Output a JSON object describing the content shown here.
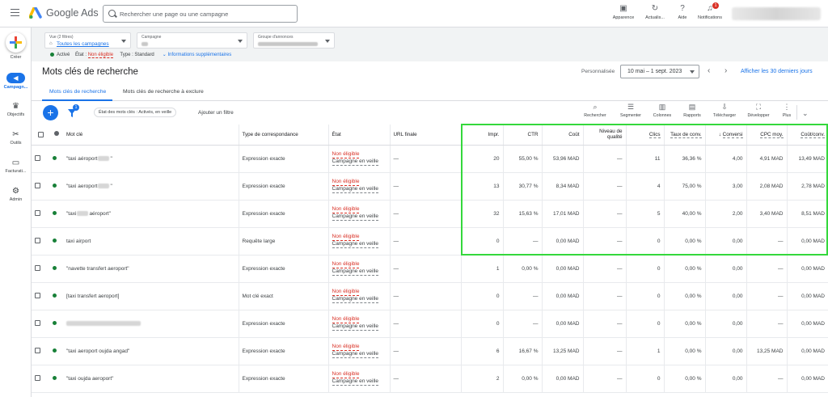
{
  "app": {
    "brand": "Google Ads",
    "search_placeholder": "Rechercher une page ou une campagne",
    "actions": [
      {
        "label": "Apparence",
        "icon": "appearance-icon"
      },
      {
        "label": "Actualis...",
        "icon": "refresh-icon"
      },
      {
        "label": "Aide",
        "icon": "help-icon"
      },
      {
        "label": "Notifications",
        "icon": "bell-icon",
        "badge": "1"
      }
    ]
  },
  "nav": {
    "create_label": "Créer",
    "items": [
      {
        "label": "Campagn...",
        "icon": "megaphone-icon"
      },
      {
        "label": "Objectifs",
        "icon": "trophy-icon"
      },
      {
        "label": "Outils",
        "icon": "tools-icon"
      },
      {
        "label": "Facturati...",
        "icon": "billing-icon"
      },
      {
        "label": "Admin",
        "icon": "admin-gear-icon"
      }
    ]
  },
  "filters": {
    "view_label": "Vue (2 filtres)",
    "view_value": "Toutes les campagnes",
    "campaign_label": "Campagne",
    "adgroup_label": "Groupe d'annonces",
    "status_active": "Activé",
    "status_label": "État :",
    "status_value": "Non éligible",
    "type_label": "Type :",
    "type_value": "Standard",
    "more_info": "Informations supplémentaires"
  },
  "page": {
    "title": "Mots clés de recherche",
    "personalize": "Personnalisée",
    "date_range": "10 mai – 1 sept. 2023",
    "last30": "Afficher les 30 derniers jours",
    "tabs": [
      "Mots clés de recherche",
      "Mots clés de recherche à exclure"
    ],
    "filter_badge": "1",
    "filter_chip": "État des mots clés : Activés, en veille",
    "add_filter": "Ajouter un filtre",
    "tools": [
      {
        "label": "Rechercher",
        "icon": "search-icon"
      },
      {
        "label": "Segmenter",
        "icon": "segment-icon"
      },
      {
        "label": "Colonnes",
        "icon": "columns-icon"
      },
      {
        "label": "Rapports",
        "icon": "reports-icon"
      },
      {
        "label": "Télécharger",
        "icon": "download-icon"
      },
      {
        "label": "Développer",
        "icon": "expand-icon"
      },
      {
        "label": "Plus",
        "icon": "more-icon"
      }
    ]
  },
  "table": {
    "headers": {
      "keyword": "Mot clé",
      "match": "Type de correspondance",
      "state": "État",
      "url": "URL finale",
      "impr": "Impr.",
      "ctr": "CTR",
      "cost": "Coût",
      "quality": "Niveau de qualité",
      "clicks": "Clics",
      "conv_rate": "Taux de conv.",
      "conversions": "Conversi",
      "cpc": "CPC moy.",
      "cost_conv": "Coût/conv."
    },
    "rows": [
      {
        "kw_pre": "\"taxi aéroport",
        "kw_post": "\"",
        "blur_mid": true,
        "match": "Expression exacte",
        "s1": "Non éligible",
        "s2": "Campagne en veille",
        "url": "—",
        "impr": "20",
        "ctr": "55,00 %",
        "cost": "53,96 MAD",
        "quality": "—",
        "clicks": "11",
        "conv_rate": "36,36 %",
        "conversions": "4,00",
        "cpc": "4,91 MAD",
        "cost_conv": "13,49 MAD"
      },
      {
        "kw_pre": "\"taxi aeroport",
        "kw_post": "\"",
        "blur_mid": true,
        "match": "Expression exacte",
        "s1": "Non éligible",
        "s2": "Campagne en veille",
        "url": "—",
        "impr": "13",
        "ctr": "30,77 %",
        "cost": "8,34 MAD",
        "quality": "—",
        "clicks": "4",
        "conv_rate": "75,00 %",
        "conversions": "3,00",
        "cpc": "2,08 MAD",
        "cost_conv": "2,78 MAD"
      },
      {
        "kw_pre": "\"taxi",
        "kw_post": "aéroport\"",
        "blur_mid": true,
        "match": "Expression exacte",
        "s1": "Non éligible",
        "s2": "Campagne en veille",
        "url": "—",
        "impr": "32",
        "ctr": "15,63 %",
        "cost": "17,01 MAD",
        "quality": "—",
        "clicks": "5",
        "conv_rate": "40,00 %",
        "conversions": "2,00",
        "cpc": "3,40 MAD",
        "cost_conv": "8,51 MAD"
      },
      {
        "kw_pre": "taxi airport",
        "kw_post": "",
        "blur_mid": false,
        "match": "Requête large",
        "s1": "Non éligible",
        "s2": "Campagne en veille",
        "url": "—",
        "impr": "0",
        "ctr": "—",
        "cost": "0,00 MAD",
        "quality": "—",
        "clicks": "0",
        "conv_rate": "0,00 %",
        "conversions": "0,00",
        "cpc": "—",
        "cost_conv": "0,00 MAD"
      },
      {
        "kw_pre": "\"navette transfert aeroport\"",
        "kw_post": "",
        "blur_mid": false,
        "match": "Expression exacte",
        "s1": "Non éligible",
        "s2": "Campagne en veille",
        "url": "—",
        "impr": "1",
        "ctr": "0,00 %",
        "cost": "0,00 MAD",
        "quality": "—",
        "clicks": "0",
        "conv_rate": "0,00 %",
        "conversions": "0,00",
        "cpc": "—",
        "cost_conv": "0,00 MAD"
      },
      {
        "kw_pre": "[taxi transfert aeroport]",
        "kw_post": "",
        "blur_mid": false,
        "match": "Mot clé exact",
        "s1": "Non éligible",
        "s2": "Campagne en veille",
        "url": "—",
        "impr": "0",
        "ctr": "—",
        "cost": "0,00 MAD",
        "quality": "—",
        "clicks": "0",
        "conv_rate": "0,00 %",
        "conversions": "0,00",
        "cpc": "—",
        "cost_conv": "0,00 MAD"
      },
      {
        "kw_pre": "",
        "kw_post": "",
        "blur_mid": false,
        "blur_full": true,
        "match": "Expression exacte",
        "s1": "Non éligible",
        "s2": "Campagne en veille",
        "url": "—",
        "impr": "0",
        "ctr": "—",
        "cost": "0,00 MAD",
        "quality": "—",
        "clicks": "0",
        "conv_rate": "0,00 %",
        "conversions": "0,00",
        "cpc": "—",
        "cost_conv": "0,00 MAD"
      },
      {
        "kw_pre": "\"taxi aeroport oujda angad\"",
        "kw_post": "",
        "blur_mid": false,
        "match": "Expression exacte",
        "s1": "Non éligible",
        "s2": "Campagne en veille",
        "url": "—",
        "impr": "6",
        "ctr": "16,67 %",
        "cost": "13,25 MAD",
        "quality": "—",
        "clicks": "1",
        "conv_rate": "0,00 %",
        "conversions": "0,00",
        "cpc": "13,25 MAD",
        "cost_conv": "0,00 MAD"
      },
      {
        "kw_pre": "\"taxi oujda aeroport\"",
        "kw_post": "",
        "blur_mid": false,
        "match": "Expression exacte",
        "s1": "Non éligible",
        "s2": "Campagne en veille",
        "url": "—",
        "impr": "2",
        "ctr": "0,00 %",
        "cost": "0,00 MAD",
        "quality": "—",
        "clicks": "0",
        "conv_rate": "0,00 %",
        "conversions": "0,00",
        "cpc": "—",
        "cost_conv": "0,00 MAD"
      }
    ]
  },
  "colors": {
    "accent": "#1a73e8",
    "error": "#d93025",
    "enabled": "#188038",
    "highlight": "#34d83c"
  }
}
